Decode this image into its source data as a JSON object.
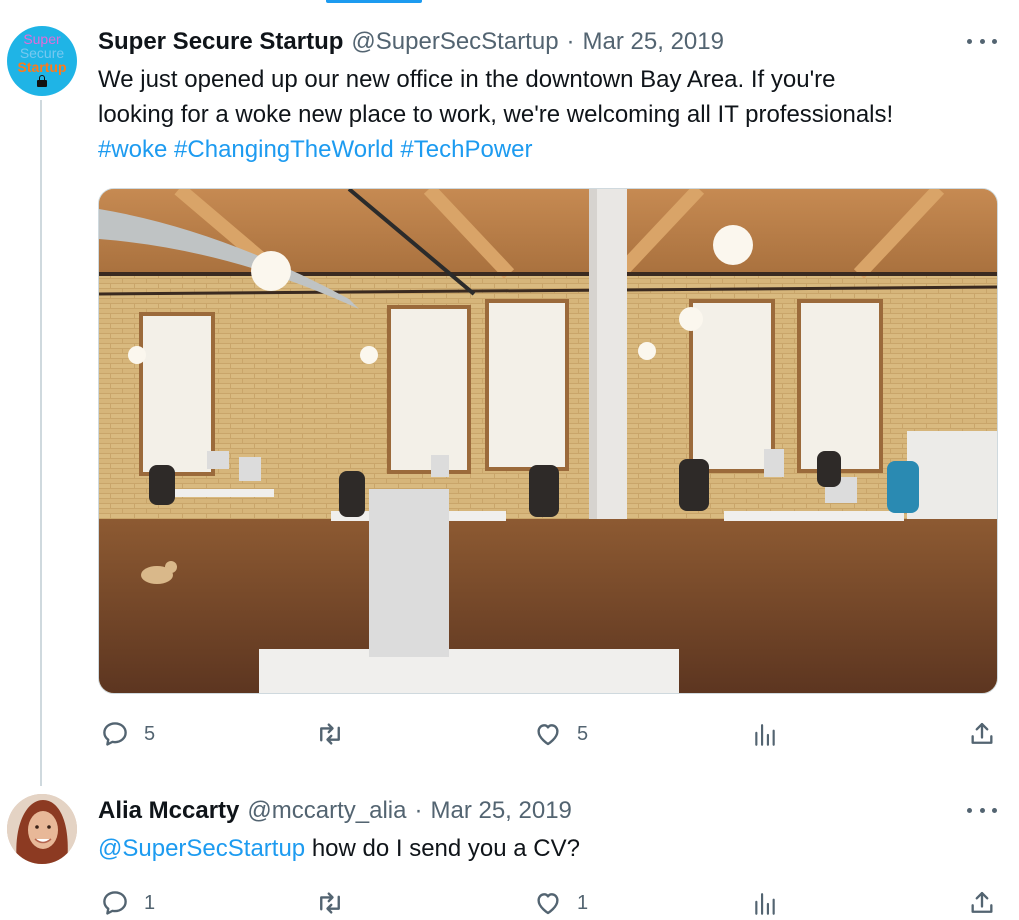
{
  "tweets": [
    {
      "avatar_text": [
        "Super",
        "Secure",
        "Startup"
      ],
      "author_name": "Super Secure Startup",
      "handle": "@SuperSecStartup",
      "separator": "·",
      "date": "Mar 25, 2019",
      "text_line1": "We just opened up our new office in the downtown Bay Area. If you're",
      "text_line2": "looking for a woke new place to work, we're welcoming all IT professionals!",
      "hashtags": [
        "#woke",
        "#ChangingTheWorld",
        "#TechPower"
      ],
      "reply_count": "5",
      "like_count": "5"
    },
    {
      "author_name": "Alia Mccarty",
      "handle": "@mccarty_alia",
      "separator": "·",
      "date": "Mar 25, 2019",
      "mention": "@SuperSecStartup",
      "text": "how do I send you a CV?",
      "reply_count": "1",
      "like_count": "1"
    }
  ],
  "icons": {
    "reply": "reply-icon",
    "retweet": "retweet-icon",
    "like": "like-icon",
    "views": "views-icon",
    "share": "share-icon",
    "more": "more-icon",
    "lock": "lock-icon"
  },
  "colors": {
    "accent": "#1d9bf0",
    "secondary_text": "#536471",
    "primary_text": "#0f1419",
    "thread_line": "#cfd9de"
  }
}
